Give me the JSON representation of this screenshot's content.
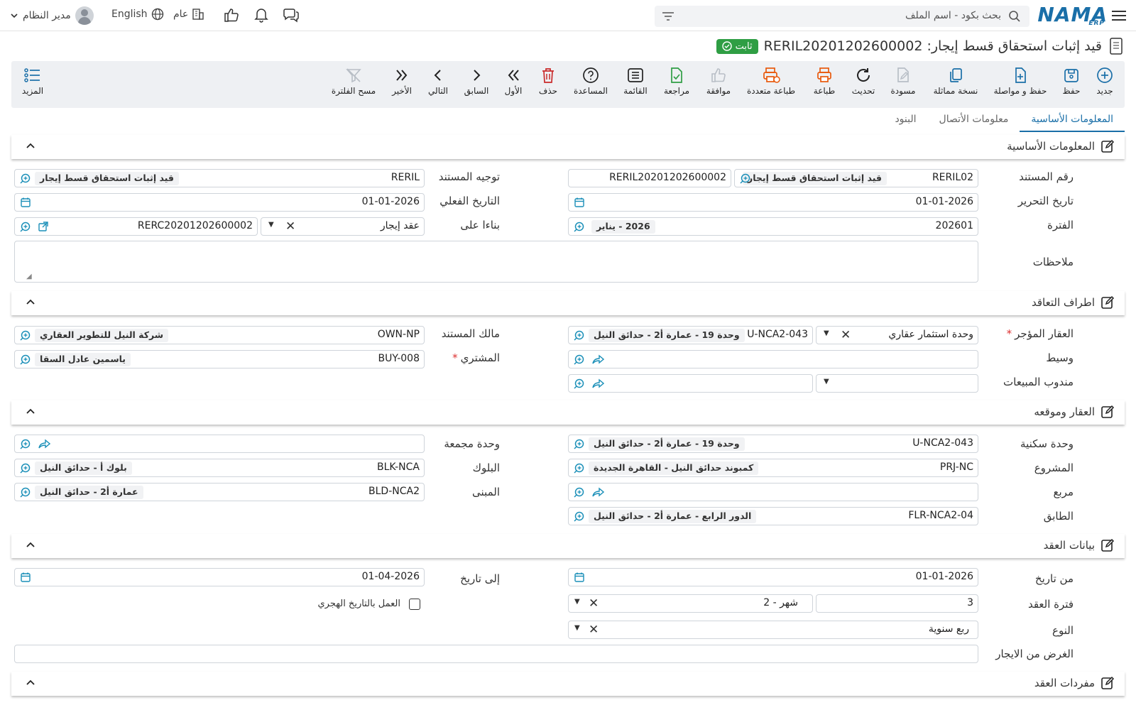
{
  "topbar": {
    "logo": "NAMA",
    "logo_sub": "ERP",
    "search_placeholder": "بحث بكود - اسم الملف",
    "company": "عام",
    "language": "English",
    "user": "مدير النظام"
  },
  "title": {
    "text": "قيد إثبات استحقاق قسط إيجار: RERIL20201202600002",
    "status": "ثابت"
  },
  "toolbar": {
    "new": "جديد",
    "save": "حفظ",
    "save_continue": "حفظ و مواصلة",
    "duplicate": "نسخة مماثلة",
    "draft": "مسودة",
    "refresh": "تحديث",
    "print": "طباعة",
    "multi_print": "طباعة متعددة",
    "approve": "موافقة",
    "review": "مراجعة",
    "list": "القائمة",
    "help": "المساعدة",
    "delete": "حذف",
    "first": "الأول",
    "previous": "السابق",
    "next": "التالي",
    "last": "الأخير",
    "clear_filter": "مسح الفلترة",
    "more": "المزيد"
  },
  "tabs": [
    "المعلومات الأساسية",
    "معلومات الأتصال",
    "البنود"
  ],
  "sections": {
    "basic": "المعلومات الأساسية",
    "parties": "اطراف التعاقد",
    "property": "العقار وموقعه",
    "contract": "بيانات العقد",
    "items": "مفردات العقد"
  },
  "basic": {
    "doc_number_label": "رقم المستند",
    "doc_number_code": "RERIL02",
    "doc_number_name": "قيد إثبات استحقاق قسط إيجار",
    "doc_number_value": "RERIL20201202600002",
    "doc_direction_label": "توجيه المستند",
    "doc_direction_code": "RERIL",
    "doc_direction_name": "قيد إثبات استحقاق قسط إيجار",
    "issue_date_label": "تاريخ التحرير",
    "issue_date": "01-01-2026",
    "actual_date_label": "التاريخ الفعلي",
    "actual_date": "01-01-2026",
    "period_label": "الفترة",
    "period_code": "202601",
    "period_name": "2026 - يناير",
    "based_on_label": "بناءا على",
    "based_on_type": "عقد إيجار",
    "based_on_value": "RERC20201202600002",
    "notes_label": "ملاحظات"
  },
  "parties": {
    "property_label": "العقار المؤجر",
    "property_type": "وحدة استثمار عقاري",
    "property_code": "U-NCA2-043",
    "property_name": "وحدة 19 - عمارة أ2 - حدائق النيل",
    "owner_label": "مالك المستند",
    "owner_code": "OWN-NP",
    "owner_name": "شركة النيل للتطوير العقاري",
    "broker_label": "وسيط",
    "buyer_label": "المشتري",
    "buyer_code": "BUY-008",
    "buyer_name": "ياسمين عادل السقا",
    "sales_rep_label": "مندوب المبيعات"
  },
  "property": {
    "unit_label": "وحدة سكنية",
    "unit_code": "U-NCA2-043",
    "unit_name": "وحدة 19 - عمارة أ2 - حدائق النيل",
    "agg_unit_label": "وحدة مجمعة",
    "project_label": "المشروع",
    "project_code": "PRJ-NC",
    "project_name": "كمبوند حدائق النيل - القاهرة الجديدة",
    "block_label": "البلوك",
    "block_code": "BLK-NCA",
    "block_name": "بلوك أ - حدائق النيل",
    "square_label": "مربع",
    "building_label": "المبنى",
    "building_code": "BLD-NCA2",
    "building_name": "عمارة أ2 - حدائق النيل",
    "floor_label": "الطابق",
    "floor_code": "FLR-NCA2-04",
    "floor_name": "الدور الرابع - عمارة أ2 - حدائق النيل"
  },
  "contract": {
    "from_label": "من تاريخ",
    "from_date": "01-01-2026",
    "to_label": "إلى تاريخ",
    "to_date": "01-04-2026",
    "period_label": "فترة العقد",
    "period_count": "3",
    "period_unit": "2 - شهر",
    "hijri_label": "العمل بالتاريخ الهجري",
    "type_label": "النوع",
    "type_value": "ربع سنوية",
    "purpose_label": "الغرض من الايجار"
  }
}
